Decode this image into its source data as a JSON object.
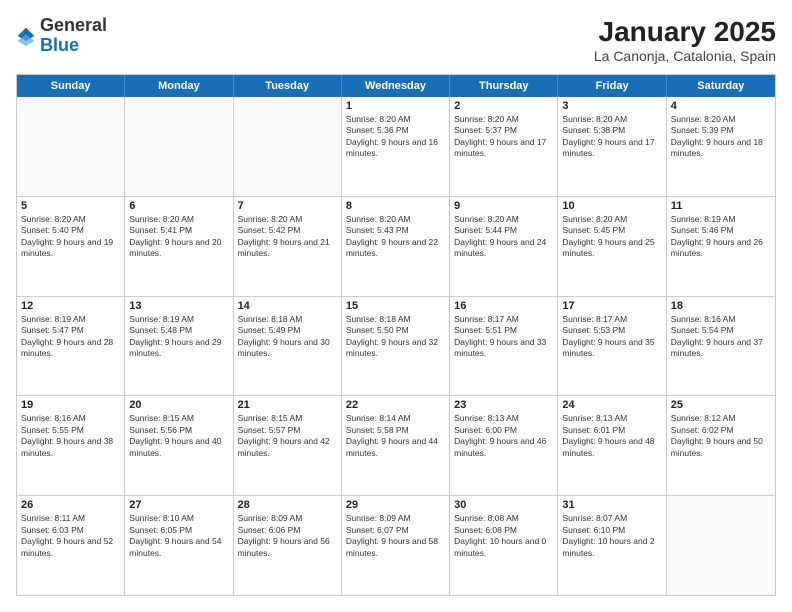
{
  "header": {
    "logo_general": "General",
    "logo_blue": "Blue",
    "title": "January 2025",
    "subtitle": "La Canonja, Catalonia, Spain"
  },
  "days_of_week": [
    "Sunday",
    "Monday",
    "Tuesday",
    "Wednesday",
    "Thursday",
    "Friday",
    "Saturday"
  ],
  "weeks": [
    [
      {
        "day": "",
        "sunrise": "",
        "sunset": "",
        "daylight": ""
      },
      {
        "day": "",
        "sunrise": "",
        "sunset": "",
        "daylight": ""
      },
      {
        "day": "",
        "sunrise": "",
        "sunset": "",
        "daylight": ""
      },
      {
        "day": "1",
        "sunrise": "Sunrise: 8:20 AM",
        "sunset": "Sunset: 5:36 PM",
        "daylight": "Daylight: 9 hours and 16 minutes."
      },
      {
        "day": "2",
        "sunrise": "Sunrise: 8:20 AM",
        "sunset": "Sunset: 5:37 PM",
        "daylight": "Daylight: 9 hours and 17 minutes."
      },
      {
        "day": "3",
        "sunrise": "Sunrise: 8:20 AM",
        "sunset": "Sunset: 5:38 PM",
        "daylight": "Daylight: 9 hours and 17 minutes."
      },
      {
        "day": "4",
        "sunrise": "Sunrise: 8:20 AM",
        "sunset": "Sunset: 5:39 PM",
        "daylight": "Daylight: 9 hours and 18 minutes."
      }
    ],
    [
      {
        "day": "5",
        "sunrise": "Sunrise: 8:20 AM",
        "sunset": "Sunset: 5:40 PM",
        "daylight": "Daylight: 9 hours and 19 minutes."
      },
      {
        "day": "6",
        "sunrise": "Sunrise: 8:20 AM",
        "sunset": "Sunset: 5:41 PM",
        "daylight": "Daylight: 9 hours and 20 minutes."
      },
      {
        "day": "7",
        "sunrise": "Sunrise: 8:20 AM",
        "sunset": "Sunset: 5:42 PM",
        "daylight": "Daylight: 9 hours and 21 minutes."
      },
      {
        "day": "8",
        "sunrise": "Sunrise: 8:20 AM",
        "sunset": "Sunset: 5:43 PM",
        "daylight": "Daylight: 9 hours and 22 minutes."
      },
      {
        "day": "9",
        "sunrise": "Sunrise: 8:20 AM",
        "sunset": "Sunset: 5:44 PM",
        "daylight": "Daylight: 9 hours and 24 minutes."
      },
      {
        "day": "10",
        "sunrise": "Sunrise: 8:20 AM",
        "sunset": "Sunset: 5:45 PM",
        "daylight": "Daylight: 9 hours and 25 minutes."
      },
      {
        "day": "11",
        "sunrise": "Sunrise: 8:19 AM",
        "sunset": "Sunset: 5:46 PM",
        "daylight": "Daylight: 9 hours and 26 minutes."
      }
    ],
    [
      {
        "day": "12",
        "sunrise": "Sunrise: 8:19 AM",
        "sunset": "Sunset: 5:47 PM",
        "daylight": "Daylight: 9 hours and 28 minutes."
      },
      {
        "day": "13",
        "sunrise": "Sunrise: 8:19 AM",
        "sunset": "Sunset: 5:48 PM",
        "daylight": "Daylight: 9 hours and 29 minutes."
      },
      {
        "day": "14",
        "sunrise": "Sunrise: 8:18 AM",
        "sunset": "Sunset: 5:49 PM",
        "daylight": "Daylight: 9 hours and 30 minutes."
      },
      {
        "day": "15",
        "sunrise": "Sunrise: 8:18 AM",
        "sunset": "Sunset: 5:50 PM",
        "daylight": "Daylight: 9 hours and 32 minutes."
      },
      {
        "day": "16",
        "sunrise": "Sunrise: 8:17 AM",
        "sunset": "Sunset: 5:51 PM",
        "daylight": "Daylight: 9 hours and 33 minutes."
      },
      {
        "day": "17",
        "sunrise": "Sunrise: 8:17 AM",
        "sunset": "Sunset: 5:53 PM",
        "daylight": "Daylight: 9 hours and 35 minutes."
      },
      {
        "day": "18",
        "sunrise": "Sunrise: 8:16 AM",
        "sunset": "Sunset: 5:54 PM",
        "daylight": "Daylight: 9 hours and 37 minutes."
      }
    ],
    [
      {
        "day": "19",
        "sunrise": "Sunrise: 8:16 AM",
        "sunset": "Sunset: 5:55 PM",
        "daylight": "Daylight: 9 hours and 38 minutes."
      },
      {
        "day": "20",
        "sunrise": "Sunrise: 8:15 AM",
        "sunset": "Sunset: 5:56 PM",
        "daylight": "Daylight: 9 hours and 40 minutes."
      },
      {
        "day": "21",
        "sunrise": "Sunrise: 8:15 AM",
        "sunset": "Sunset: 5:57 PM",
        "daylight": "Daylight: 9 hours and 42 minutes."
      },
      {
        "day": "22",
        "sunrise": "Sunrise: 8:14 AM",
        "sunset": "Sunset: 5:58 PM",
        "daylight": "Daylight: 9 hours and 44 minutes."
      },
      {
        "day": "23",
        "sunrise": "Sunrise: 8:13 AM",
        "sunset": "Sunset: 6:00 PM",
        "daylight": "Daylight: 9 hours and 46 minutes."
      },
      {
        "day": "24",
        "sunrise": "Sunrise: 8:13 AM",
        "sunset": "Sunset: 6:01 PM",
        "daylight": "Daylight: 9 hours and 48 minutes."
      },
      {
        "day": "25",
        "sunrise": "Sunrise: 8:12 AM",
        "sunset": "Sunset: 6:02 PM",
        "daylight": "Daylight: 9 hours and 50 minutes."
      }
    ],
    [
      {
        "day": "26",
        "sunrise": "Sunrise: 8:11 AM",
        "sunset": "Sunset: 6:03 PM",
        "daylight": "Daylight: 9 hours and 52 minutes."
      },
      {
        "day": "27",
        "sunrise": "Sunrise: 8:10 AM",
        "sunset": "Sunset: 6:05 PM",
        "daylight": "Daylight: 9 hours and 54 minutes."
      },
      {
        "day": "28",
        "sunrise": "Sunrise: 8:09 AM",
        "sunset": "Sunset: 6:06 PM",
        "daylight": "Daylight: 9 hours and 56 minutes."
      },
      {
        "day": "29",
        "sunrise": "Sunrise: 8:09 AM",
        "sunset": "Sunset: 6:07 PM",
        "daylight": "Daylight: 9 hours and 58 minutes."
      },
      {
        "day": "30",
        "sunrise": "Sunrise: 8:08 AM",
        "sunset": "Sunset: 6:08 PM",
        "daylight": "Daylight: 10 hours and 0 minutes."
      },
      {
        "day": "31",
        "sunrise": "Sunrise: 8:07 AM",
        "sunset": "Sunset: 6:10 PM",
        "daylight": "Daylight: 10 hours and 2 minutes."
      },
      {
        "day": "",
        "sunrise": "",
        "sunset": "",
        "daylight": ""
      }
    ]
  ]
}
